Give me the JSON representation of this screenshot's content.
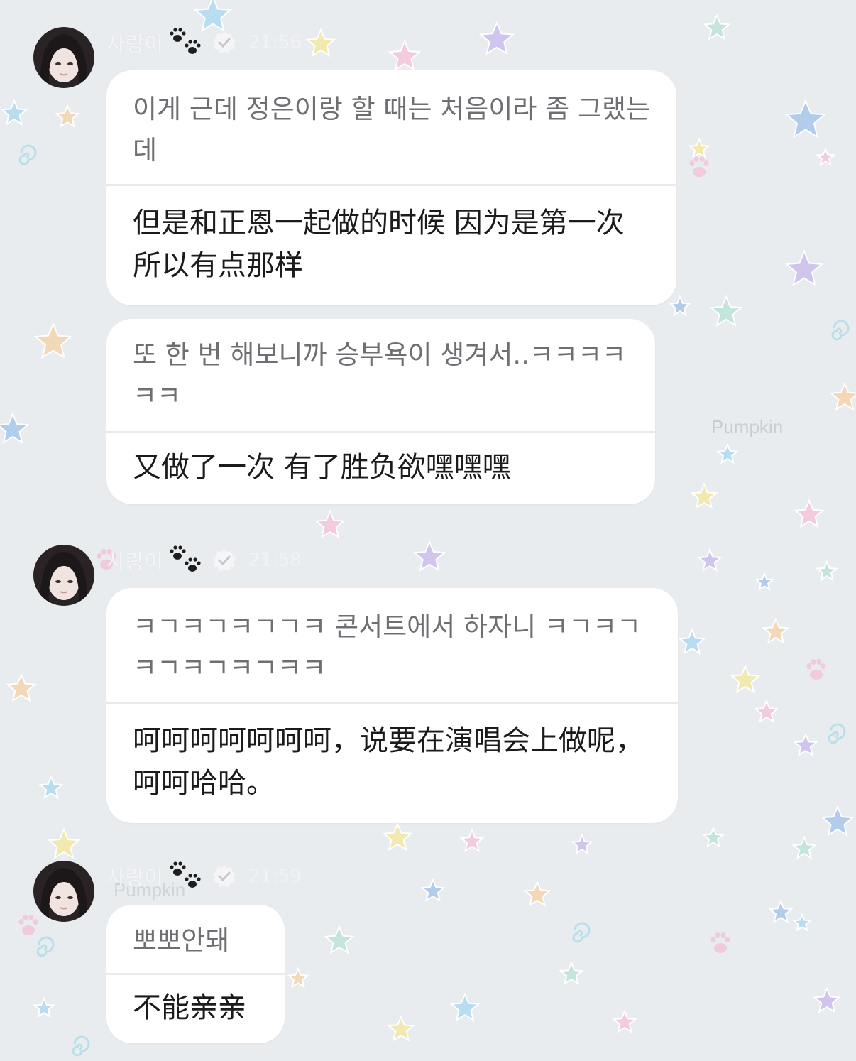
{
  "theme": {
    "background": "#e8ecee",
    "bubble": "#ffffff",
    "original_text": "#6f6f73",
    "translated_text": "#1b1b1d",
    "divider": "#eaeaec"
  },
  "messages": [
    {
      "sender": "사랑이",
      "badge_icon": "paw-prints-icon",
      "verified_icon": "verified-check-icon",
      "time": "21:56",
      "bubbles": [
        {
          "original": "이게 근데 정은이랑 할 때는 처음이라 좀 그랬는데",
          "translation": "但是和正恩一起做的时候 因为是第一次 所以有点那样"
        },
        {
          "original": "또 한 번 해보니까 승부욕이 생겨서..ㅋㅋㅋㅋㅋㅋ",
          "translation": "又做了一次 有了胜负欲嘿嘿嘿"
        }
      ]
    },
    {
      "sender": "사랑이",
      "badge_icon": "paw-prints-icon",
      "verified_icon": "verified-check-icon",
      "time": "21:58",
      "bubbles": [
        {
          "original": "ㅋㄱㅋㄱㅋㄱㄱㅋ 콘서트에서 하자니 ㅋㄱㅋㄱㅋㄱㅋㄱㅋㄱㅋㅋ",
          "translation": "呵呵呵呵呵呵呵，说要在演唱会上做呢，呵呵哈哈。"
        }
      ]
    },
    {
      "sender": "사랑이",
      "badge_icon": "paw-prints-icon",
      "verified_icon": "verified-check-icon",
      "time": "21:59",
      "bubbles": [
        {
          "original": "뽀뽀안돼",
          "translation": "不能亲亲"
        }
      ]
    }
  ],
  "background_decor": {
    "icons": [
      "star-icon",
      "paw-icon",
      "swirl-icon"
    ],
    "watermark": "Pumpkin"
  }
}
